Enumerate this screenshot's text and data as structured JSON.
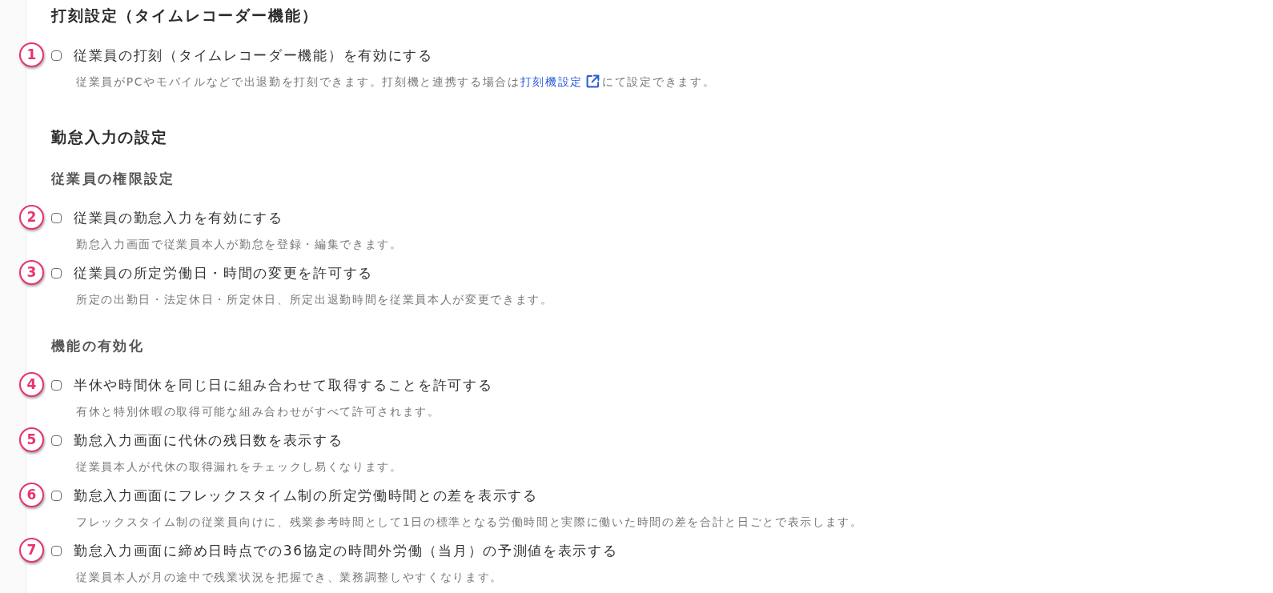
{
  "sections": [
    {
      "title": "打刻設定（タイムレコーダー機能）",
      "groups": [
        {
          "items": [
            {
              "marker": "1",
              "label": "従業員の打刻（タイムレコーダー機能）を有効にする",
              "checked": false,
              "description": [
                {
                  "kind": "text",
                  "text": "従業員がPCやモバイルなどで出退勤を打刻できます。打刻機と連携する場合は"
                },
                {
                  "kind": "link",
                  "text": "打刻機設定"
                },
                {
                  "kind": "text",
                  "text": "にて設定できます。"
                }
              ]
            }
          ]
        }
      ]
    },
    {
      "title": "勤怠入力の設定",
      "groups": [
        {
          "title": "従業員の権限設定",
          "items": [
            {
              "marker": "2",
              "label": "従業員の勤怠入力を有効にする",
              "checked": false,
              "description": [
                {
                  "kind": "text",
                  "text": "勤怠入力画面で従業員本人が勤怠を登録・編集できます。"
                }
              ]
            },
            {
              "marker": "3",
              "label": "従業員の所定労働日・時間の変更を許可する",
              "checked": false,
              "description": [
                {
                  "kind": "text",
                  "text": "所定の出勤日・法定休日・所定休日、所定出退勤時間を従業員本人が変更できます。"
                }
              ]
            }
          ]
        },
        {
          "title": "機能の有効化",
          "items": [
            {
              "marker": "4",
              "label": "半休や時間休を同じ日に組み合わせて取得することを許可する",
              "checked": false,
              "description": [
                {
                  "kind": "text",
                  "text": "有休と特別休暇の取得可能な組み合わせがすべて許可されます。"
                }
              ]
            },
            {
              "marker": "5",
              "label": "勤怠入力画面に代休の残日数を表示する",
              "checked": false,
              "description": [
                {
                  "kind": "text",
                  "text": "従業員本人が代休の取得漏れをチェックし易くなります。"
                }
              ]
            },
            {
              "marker": "6",
              "label": "勤怠入力画面にフレックスタイム制の所定労働時間との差を表示する",
              "checked": false,
              "description": [
                {
                  "kind": "text",
                  "text": "フレックスタイム制の従業員向けに、残業参考時間として1日の標準となる労働時間と実際に働いた時間の差を合計と日ごとで表示します。"
                }
              ]
            },
            {
              "marker": "7",
              "label": "勤怠入力画面に締め日時点での36協定の時間外労働（当月）の予測値を表示する",
              "checked": false,
              "description": [
                {
                  "kind": "text",
                  "text": "従業員本人が月の途中で残業状況を把握でき、業務調整しやすくなります。"
                }
              ]
            }
          ]
        }
      ]
    }
  ]
}
